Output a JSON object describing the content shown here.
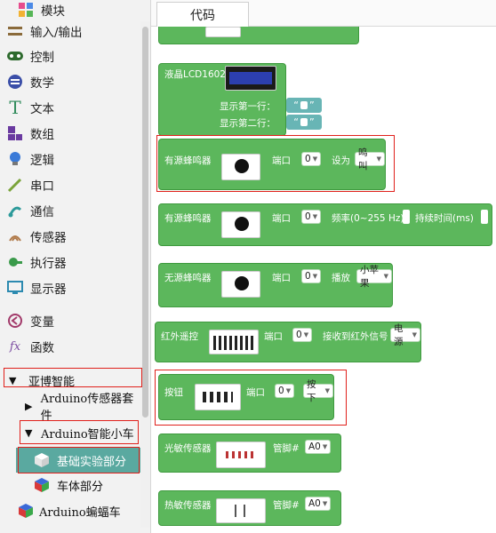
{
  "sidebar": {
    "header_label": "模块",
    "categories": [
      {
        "label": "输入/输出",
        "icon": "io-icon"
      },
      {
        "label": "控制",
        "icon": "gamepad-icon"
      },
      {
        "label": "数学",
        "icon": "math-icon"
      },
      {
        "label": "文本",
        "icon": "text-icon"
      },
      {
        "label": "数组",
        "icon": "array-icon"
      },
      {
        "label": "逻辑",
        "icon": "logic-icon"
      },
      {
        "label": "串口",
        "icon": "serial-icon"
      },
      {
        "label": "通信",
        "icon": "comm-icon"
      },
      {
        "label": "传感器",
        "icon": "sensor-icon"
      },
      {
        "label": "执行器",
        "icon": "actuator-icon"
      },
      {
        "label": "显示器",
        "icon": "display-icon"
      },
      {
        "label": "变量",
        "icon": "variable-icon"
      },
      {
        "label": "函数",
        "icon": "function-icon"
      }
    ],
    "tree": {
      "group": "亚博智能",
      "kit": "Arduino传感器套件",
      "car": "Arduino智能小车",
      "basic": "基础实验部分",
      "body": "车体部分",
      "bat": "Arduino蝙蝠车"
    }
  },
  "workspace": {
    "tab_label": "代码",
    "lcd": {
      "title": "液晶LCD1602",
      "line1": "显示第一行：",
      "line2": "显示第二行：",
      "quote": "“”"
    },
    "buzzer_active_1": {
      "title": "有源蜂鸣器",
      "port_label": "端口",
      "port": "0",
      "set_label": "设为",
      "set_value": "鸣叫"
    },
    "buzzer_active_2": {
      "title": "有源蜂鸣器",
      "port_label": "端口",
      "port": "0",
      "freq_label": "频率(0~255 Hz)",
      "dur_label": "持续时间(ms)"
    },
    "buzzer_passive": {
      "title": "无源蜂鸣器",
      "port_label": "端口",
      "port": "0",
      "play_label": "播放",
      "song": "小苹果"
    },
    "ir": {
      "title": "红外遥控",
      "port_label": "端口",
      "port": "0",
      "recv_label": "接收到红外信号",
      "signal": "电源"
    },
    "button": {
      "title": "按钮",
      "port_label": "端口",
      "port": "0",
      "state": "按下"
    },
    "light": {
      "title": "光敏传感器",
      "pin_label": "管脚#",
      "pin": "A0"
    },
    "thermal": {
      "title": "热敏传感器",
      "pin_label": "管脚#",
      "pin": "A0"
    }
  },
  "colors": {
    "block_green": "#5cb75c",
    "highlight_red": "#e0201b",
    "sidebar_bg": "#f2f2f2",
    "selected_bg": "#5aa9a0"
  }
}
